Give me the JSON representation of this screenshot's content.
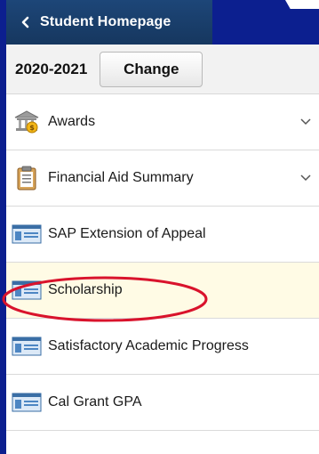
{
  "header": {
    "back_label": "Student Homepage"
  },
  "year_selector": {
    "year": "2020-2021",
    "change_label": "Change"
  },
  "menu": {
    "items": [
      {
        "label": "Awards",
        "icon": "awards-icon",
        "expandable": true
      },
      {
        "label": "Financial Aid Summary",
        "icon": "clipboard-icon",
        "expandable": true
      },
      {
        "label": "SAP Extension of Appeal",
        "icon": "form-icon",
        "expandable": false
      },
      {
        "label": "Scholarship",
        "icon": "form-icon",
        "expandable": false
      },
      {
        "label": "Satisfactory Academic Progress",
        "icon": "form-icon",
        "expandable": false
      },
      {
        "label": "Cal Grant GPA",
        "icon": "form-icon",
        "expandable": false
      }
    ]
  },
  "annotation": {
    "circle_color": "#d9132c"
  },
  "colors": {
    "background": "#0c1f8f",
    "header": "#1d4678",
    "highlight_row": "#fffbe5"
  }
}
